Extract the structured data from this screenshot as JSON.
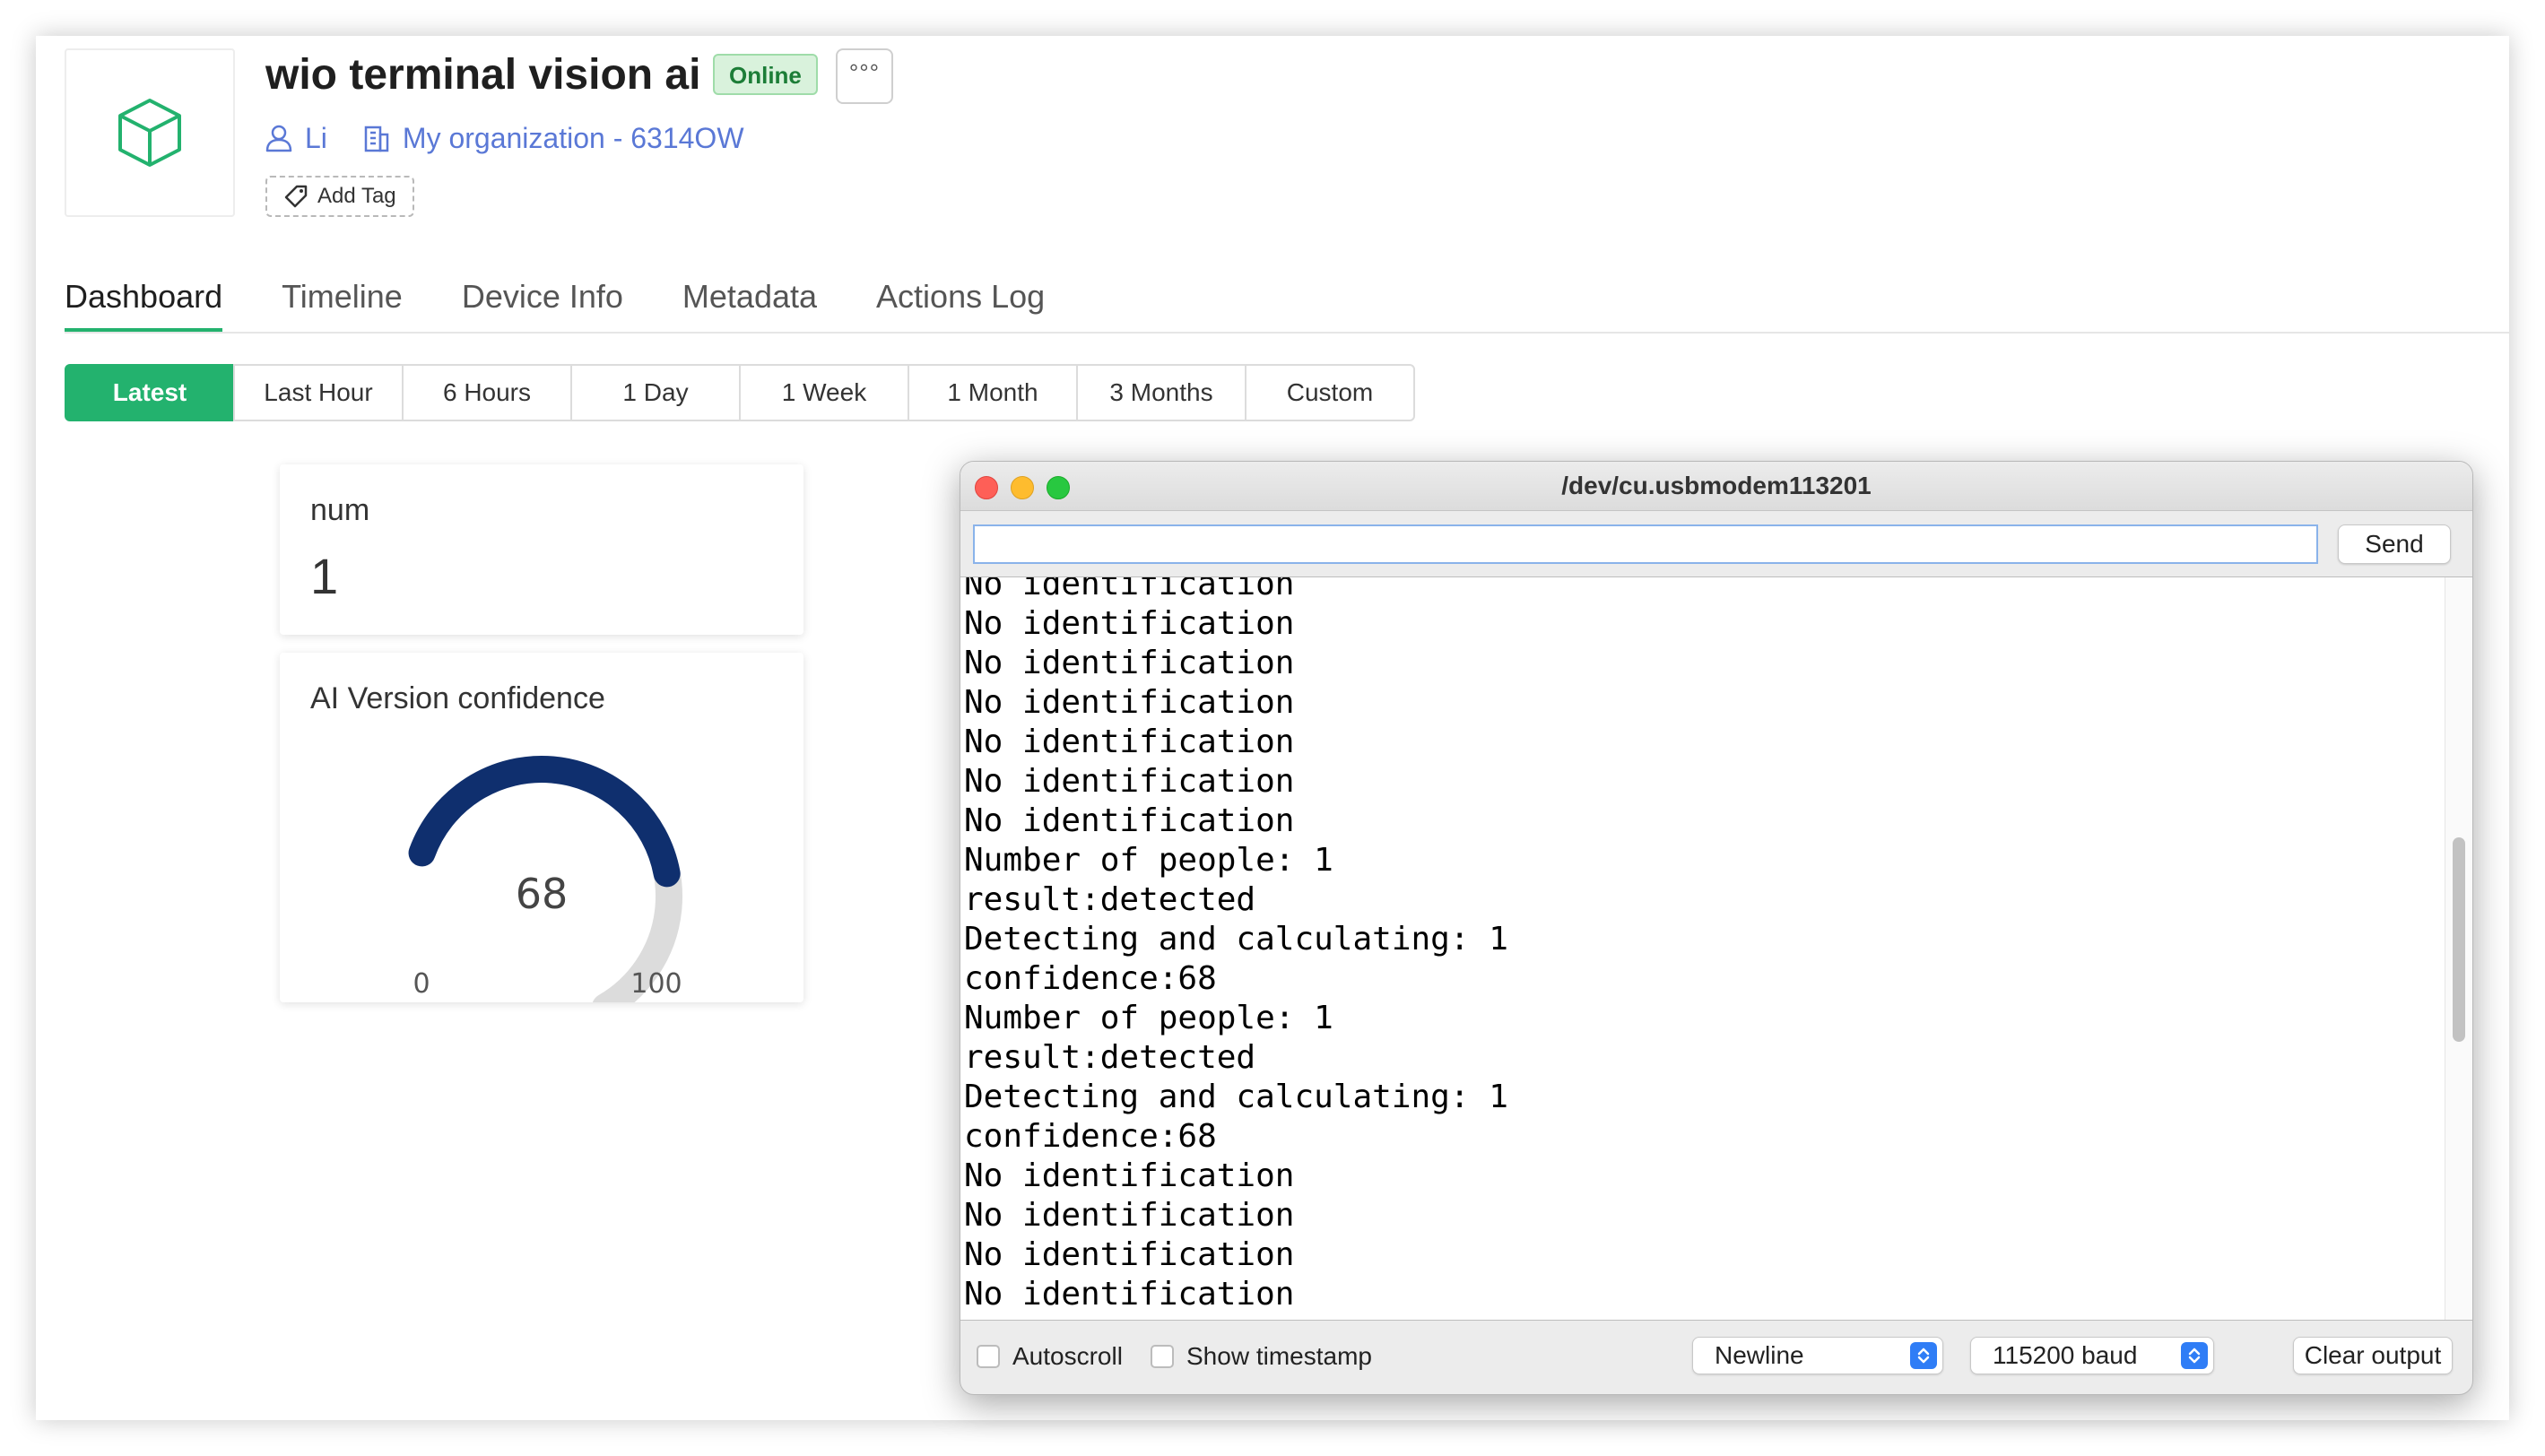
{
  "device": {
    "title": "wio terminal vision ai",
    "status": "Online",
    "more": "°°°",
    "owner": "Li",
    "organization": "My organization - 6314OW",
    "add_tag": "Add Tag"
  },
  "tabs": [
    {
      "label": "Dashboard",
      "active": true
    },
    {
      "label": "Timeline"
    },
    {
      "label": "Device Info"
    },
    {
      "label": "Metadata"
    },
    {
      "label": "Actions Log"
    }
  ],
  "ranges": [
    {
      "label": "Latest",
      "active": true
    },
    {
      "label": "Last Hour"
    },
    {
      "label": "6 Hours"
    },
    {
      "label": "1 Day"
    },
    {
      "label": "1 Week"
    },
    {
      "label": "1 Month"
    },
    {
      "label": "3 Months"
    },
    {
      "label": "Custom"
    }
  ],
  "widgets": {
    "num": {
      "label": "num",
      "value": "1"
    },
    "gauge": {
      "label": "AI Version confidence",
      "value": 68,
      "value_text": "68",
      "min": 0,
      "min_text": "0",
      "max": 100,
      "max_text": "100"
    }
  },
  "serial_monitor": {
    "title": "/dev/cu.usbmodem113201",
    "input_value": "",
    "send_label": "Send",
    "lines": [
      "No identification",
      "No identification",
      "No identification",
      "No identification",
      "No identification",
      "No identification",
      "No identification",
      "Number of people: 1",
      "result:detected",
      "Detecting and calculating: 1",
      "confidence:68",
      "Number of people: 1",
      "result:detected",
      "Detecting and calculating: 1",
      "confidence:68",
      "No identification",
      "No identification",
      "No identification",
      "No identification"
    ],
    "autoscroll_label": "Autoscroll",
    "timestamp_label": "Show timestamp",
    "line_ending": "Newline",
    "baud": "115200 baud",
    "clear_label": "Clear output"
  },
  "colors": {
    "accent": "#23b26e",
    "gauge_fill": "#0f2f6e",
    "gauge_track": "#dcdcdc",
    "link": "#5a78d6"
  }
}
